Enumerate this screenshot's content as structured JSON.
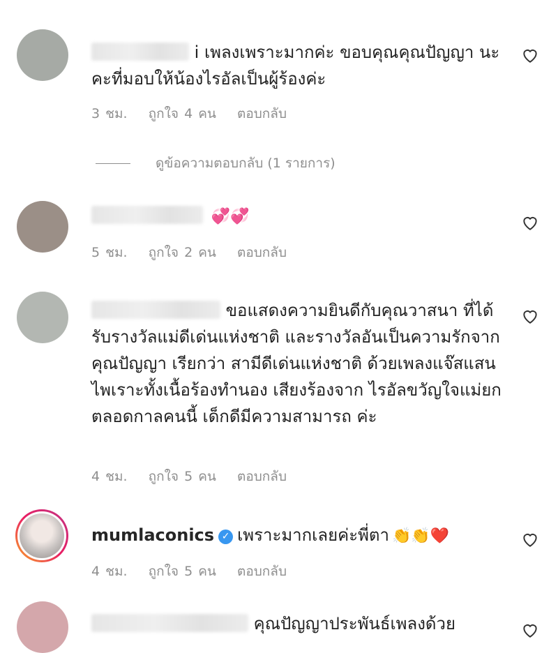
{
  "comments": [
    {
      "text": "i เพลงเพราะมากค่ะ ขอบคุณคุณปัญญา นะคะที่มอบให้น้องไรอัลเป็นผู้ร้องค่ะ",
      "time": "3 ชม.",
      "likes": "ถูกใจ 4 คน",
      "reply": "ตอบกลับ",
      "avatar_color": "#a6aaa5"
    },
    {
      "text": "",
      "emoji": "💞💞",
      "time": "5 ชม.",
      "likes": "ถูกใจ 2 คน",
      "reply": "ตอบกลับ",
      "avatar_color": "#9b8f87"
    },
    {
      "text": "ขอแสดงความยินดีกับคุณวาสนา ที่ได้รับรางวัลแม่ดีเด่นแห่งชาติ และรางวัลอันเป็นความรักจาก คุณปัญญา เรียกว่า สามีดีเด่นแห่งชาติ ด้วยเพลงแจ๊สแสนไพเราะทั้งเนื้อร้องทำนอง เสียงร้องจาก ไรอัลขวัญใจแม่ยก ตลอดกาลคนนี้ เด็กดีมีความสามารถ ค่ะ",
      "time": "4 ชม.",
      "likes": "ถูกใจ 5 คน",
      "reply": "ตอบกลับ",
      "avatar_color": "#b3b7b2"
    },
    {
      "username": "mumlaconics",
      "text": "เพราะมากเลยค่ะพี่ตา",
      "emoji": "👏👏❤️",
      "time": "4 ชม.",
      "likes": "ถูกใจ 5 คน",
      "reply": "ตอบกลับ",
      "avatar_color": "#d9d6d4"
    },
    {
      "text": "คุณปัญญาประพันธ์เพลงด้วย",
      "avatar_color": "#d4a7ab"
    }
  ],
  "view_replies": "ดูข้อความตอบกลับ (1 รายการ)",
  "icons": {
    "like": "heart-outline-icon",
    "verified": "verified-badge-icon"
  }
}
